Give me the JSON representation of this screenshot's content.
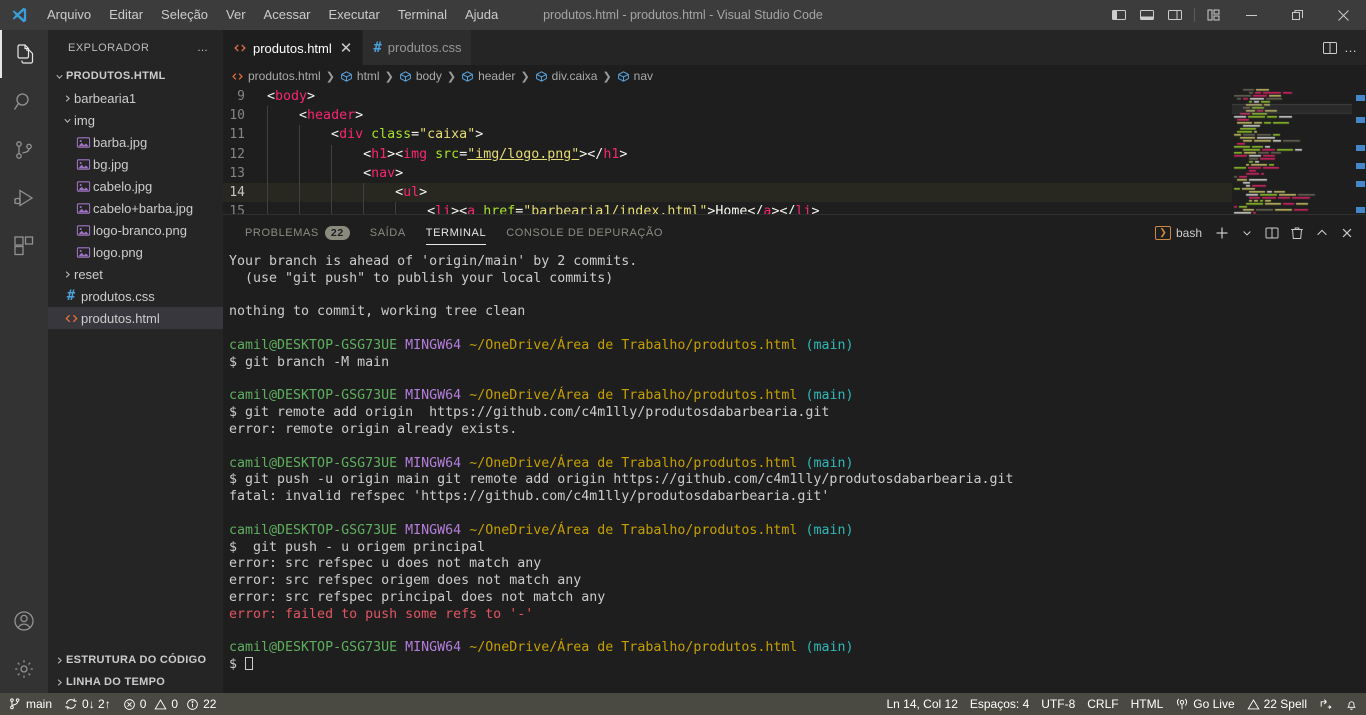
{
  "titlebar": {
    "title": "produtos.html - produtos.html - Visual Studio Code",
    "menu": [
      "Arquivo",
      "Editar",
      "Seleção",
      "Ver",
      "Acessar",
      "Executar",
      "Terminal",
      "Ajuda"
    ],
    "layout_icons": [
      "toggle-primary-sidebar-icon",
      "toggle-panel-icon",
      "toggle-secondary-sidebar-icon",
      "customize-layout-icon"
    ],
    "window_controls": [
      "minimize-button",
      "restore-button",
      "close-button"
    ]
  },
  "activitybar": {
    "items": [
      {
        "name": "explorer",
        "icon": "files-icon",
        "active": true
      },
      {
        "name": "search",
        "icon": "search-icon",
        "active": false
      },
      {
        "name": "source-control",
        "icon": "source-control-icon",
        "active": false
      },
      {
        "name": "run-debug",
        "icon": "run-debug-icon",
        "active": false
      },
      {
        "name": "extensions",
        "icon": "extensions-icon",
        "active": false
      }
    ],
    "bottom": [
      {
        "name": "accounts",
        "icon": "account-icon"
      },
      {
        "name": "manage",
        "icon": "gear-icon"
      }
    ]
  },
  "sidebar": {
    "header": "EXPLORADOR",
    "header_actions": "…",
    "root": "PRODUTOS.HTML",
    "tree": [
      {
        "label": "barbearia1",
        "type": "folder",
        "expanded": false,
        "indent": 1
      },
      {
        "label": "img",
        "type": "folder",
        "expanded": true,
        "indent": 1
      },
      {
        "label": "barba.jpg",
        "type": "image",
        "indent": 2
      },
      {
        "label": "bg.jpg",
        "type": "image",
        "indent": 2
      },
      {
        "label": "cabelo.jpg",
        "type": "image",
        "indent": 2
      },
      {
        "label": "cabelo+barba.jpg",
        "type": "image",
        "indent": 2
      },
      {
        "label": "logo-branco.png",
        "type": "image",
        "indent": 2
      },
      {
        "label": "logo.png",
        "type": "image",
        "indent": 2
      },
      {
        "label": "reset",
        "type": "folder",
        "expanded": false,
        "indent": 1
      },
      {
        "label": "produtos.css",
        "type": "css",
        "indent": 1
      },
      {
        "label": "produtos.html",
        "type": "html",
        "indent": 1,
        "selected": true
      }
    ],
    "bottom_sections": [
      "ESTRUTURA DO CÓDIGO",
      "LINHA DO TEMPO"
    ]
  },
  "editor": {
    "tabs": [
      {
        "label": "produtos.html",
        "icon": "html-file-icon",
        "active": true,
        "closable": true
      },
      {
        "label": "produtos.css",
        "icon": "css-file-icon",
        "active": false,
        "closable": false
      }
    ],
    "tab_actions": [
      "split-editor-icon",
      "more-actions-icon"
    ],
    "breadcrumbs": [
      {
        "label": "produtos.html",
        "icon": "html-file-icon"
      },
      {
        "label": "html",
        "icon": "symbol-field-icon"
      },
      {
        "label": "body",
        "icon": "symbol-field-icon"
      },
      {
        "label": "header",
        "icon": "symbol-field-icon"
      },
      {
        "label": "div.caixa",
        "icon": "symbol-field-icon"
      },
      {
        "label": "nav",
        "icon": "symbol-field-icon"
      }
    ],
    "lines": [
      {
        "num": "9",
        "indent": 0,
        "highlight": false,
        "tokens": [
          {
            "t": "punc",
            "v": "<"
          },
          {
            "t": "tag",
            "v": "body"
          },
          {
            "t": "punc",
            "v": ">"
          }
        ]
      },
      {
        "num": "10",
        "indent": 1,
        "highlight": false,
        "tokens": [
          {
            "t": "plain",
            "v": "    "
          },
          {
            "t": "punc",
            "v": "<"
          },
          {
            "t": "tag",
            "v": "header"
          },
          {
            "t": "punc",
            "v": ">"
          }
        ]
      },
      {
        "num": "11",
        "indent": 2,
        "highlight": false,
        "tokens": [
          {
            "t": "plain",
            "v": "        "
          },
          {
            "t": "punc",
            "v": "<"
          },
          {
            "t": "tag",
            "v": "div"
          },
          {
            "t": "plain",
            "v": " "
          },
          {
            "t": "attr",
            "v": "class"
          },
          {
            "t": "punc",
            "v": "="
          },
          {
            "t": "str",
            "v": "\"caixa\""
          },
          {
            "t": "punc",
            "v": ">"
          }
        ]
      },
      {
        "num": "12",
        "indent": 3,
        "highlight": false,
        "tokens": [
          {
            "t": "plain",
            "v": "            "
          },
          {
            "t": "punc",
            "v": "<"
          },
          {
            "t": "tag",
            "v": "h1"
          },
          {
            "t": "punc",
            "v": "><"
          },
          {
            "t": "tag",
            "v": "img"
          },
          {
            "t": "plain",
            "v": " "
          },
          {
            "t": "attr",
            "v": "src"
          },
          {
            "t": "punc",
            "v": "="
          },
          {
            "t": "link",
            "v": "\"img/logo.png\""
          },
          {
            "t": "punc",
            "v": "></"
          },
          {
            "t": "tag",
            "v": "h1"
          },
          {
            "t": "punc",
            "v": ">"
          }
        ]
      },
      {
        "num": "13",
        "indent": 3,
        "highlight": false,
        "tokens": [
          {
            "t": "plain",
            "v": "            "
          },
          {
            "t": "punc",
            "v": "<"
          },
          {
            "t": "tag",
            "v": "nav"
          },
          {
            "t": "punc",
            "v": ">"
          }
        ]
      },
      {
        "num": "14",
        "indent": 4,
        "highlight": true,
        "tokens": [
          {
            "t": "plain",
            "v": "                "
          },
          {
            "t": "punc",
            "v": "<"
          },
          {
            "t": "tag",
            "v": "ul"
          },
          {
            "t": "punc",
            "v": ">"
          }
        ]
      },
      {
        "num": "15",
        "indent": 5,
        "highlight": false,
        "tokens": [
          {
            "t": "plain",
            "v": "                    "
          },
          {
            "t": "punc",
            "v": "<"
          },
          {
            "t": "tag",
            "v": "li"
          },
          {
            "t": "punc",
            "v": "><"
          },
          {
            "t": "tag",
            "v": "a"
          },
          {
            "t": "plain",
            "v": " "
          },
          {
            "t": "attr",
            "v": "href"
          },
          {
            "t": "punc",
            "v": "="
          },
          {
            "t": "link",
            "v": "\"barbearia1/index.html\""
          },
          {
            "t": "punc",
            "v": ">"
          },
          {
            "t": "txt",
            "v": "Home"
          },
          {
            "t": "punc",
            "v": "</"
          },
          {
            "t": "tag",
            "v": "a"
          },
          {
            "t": "punc",
            "v": "></"
          },
          {
            "t": "tag",
            "v": "li"
          },
          {
            "t": "punc",
            "v": ">"
          }
        ]
      }
    ]
  },
  "panel": {
    "tabs": [
      {
        "label": "PROBLEMAS",
        "badge": "22",
        "active": false
      },
      {
        "label": "SAÍDA",
        "badge": "",
        "active": false
      },
      {
        "label": "TERMINAL",
        "badge": "",
        "active": true
      },
      {
        "label": "CONSOLE DE DEPURAÇÃO",
        "badge": "",
        "active": false
      }
    ],
    "shell": "bash",
    "actions": [
      "new-terminal-icon",
      "terminal-dropdown-icon",
      "split-terminal-icon",
      "kill-terminal-icon",
      "maximize-panel-icon",
      "close-panel-icon"
    ],
    "terminal_lines": [
      [
        {
          "c": "w",
          "v": "Your branch is ahead of 'origin/main' by 2 commits."
        }
      ],
      [
        {
          "c": "w",
          "v": "  (use \"git push\" to publish your local commits)"
        }
      ],
      [],
      [
        {
          "c": "w",
          "v": "nothing to commit, working tree clean"
        }
      ],
      [],
      [
        {
          "c": "g",
          "v": "camil@DESKTOP-GSG73UE"
        },
        {
          "c": "w",
          "v": " "
        },
        {
          "c": "m",
          "v": "MINGW64"
        },
        {
          "c": "w",
          "v": " "
        },
        {
          "c": "y",
          "v": "~/OneDrive/Área de Trabalho/produtos.html"
        },
        {
          "c": "w",
          "v": " "
        },
        {
          "c": "c",
          "v": "(main)"
        }
      ],
      [
        {
          "c": "w",
          "v": "$ git branch -M main"
        }
      ],
      [],
      [
        {
          "c": "g",
          "v": "camil@DESKTOP-GSG73UE"
        },
        {
          "c": "w",
          "v": " "
        },
        {
          "c": "m",
          "v": "MINGW64"
        },
        {
          "c": "w",
          "v": " "
        },
        {
          "c": "y",
          "v": "~/OneDrive/Área de Trabalho/produtos.html"
        },
        {
          "c": "w",
          "v": " "
        },
        {
          "c": "c",
          "v": "(main)"
        }
      ],
      [
        {
          "c": "w",
          "v": "$ git remote add origin  https://github.com/c4m1lly/produtosdabarbearia.git"
        }
      ],
      [
        {
          "c": "w",
          "v": "error: remote origin already exists."
        }
      ],
      [],
      [
        {
          "c": "g",
          "v": "camil@DESKTOP-GSG73UE"
        },
        {
          "c": "w",
          "v": " "
        },
        {
          "c": "m",
          "v": "MINGW64"
        },
        {
          "c": "w",
          "v": " "
        },
        {
          "c": "y",
          "v": "~/OneDrive/Área de Trabalho/produtos.html"
        },
        {
          "c": "w",
          "v": " "
        },
        {
          "c": "c",
          "v": "(main)"
        }
      ],
      [
        {
          "c": "w",
          "v": "$ git push -u origin main git remote add origin https://github.com/c4m1lly/produtosdabarbearia.git"
        }
      ],
      [
        {
          "c": "w",
          "v": "fatal: invalid refspec 'https://github.com/c4m1lly/produtosdabarbearia.git'"
        }
      ],
      [],
      [
        {
          "c": "g",
          "v": "camil@DESKTOP-GSG73UE"
        },
        {
          "c": "w",
          "v": " "
        },
        {
          "c": "m",
          "v": "MINGW64"
        },
        {
          "c": "w",
          "v": " "
        },
        {
          "c": "y",
          "v": "~/OneDrive/Área de Trabalho/produtos.html"
        },
        {
          "c": "w",
          "v": " "
        },
        {
          "c": "c",
          "v": "(main)"
        }
      ],
      [
        {
          "c": "w",
          "v": "$  git push - u origem principal"
        }
      ],
      [
        {
          "c": "w",
          "v": "error: src refspec u does not match any"
        }
      ],
      [
        {
          "c": "w",
          "v": "error: src refspec origem does not match any"
        }
      ],
      [
        {
          "c": "w",
          "v": "error: src refspec principal does not match any"
        }
      ],
      [
        {
          "c": "r",
          "v": "error: failed to push some refs to '-'"
        }
      ],
      [],
      [
        {
          "c": "g",
          "v": "camil@DESKTOP-GSG73UE"
        },
        {
          "c": "w",
          "v": " "
        },
        {
          "c": "m",
          "v": "MINGW64"
        },
        {
          "c": "w",
          "v": " "
        },
        {
          "c": "y",
          "v": "~/OneDrive/Área de Trabalho/produtos.html"
        },
        {
          "c": "w",
          "v": " "
        },
        {
          "c": "c",
          "v": "(main)"
        }
      ],
      [
        {
          "c": "w",
          "v": "$ "
        },
        {
          "c": "cursor",
          "v": ""
        }
      ]
    ]
  },
  "statusbar": {
    "branch": "main",
    "sync": "0↓ 2↑",
    "errors": "0",
    "warnings": "0",
    "infos": "22",
    "position": "Ln 14, Col 12",
    "indentation": "Espaços: 4",
    "encoding": "UTF-8",
    "eol": "CRLF",
    "language": "HTML",
    "golive": "Go Live",
    "spell": "22 Spell",
    "remote_icon": "remote-window-icon",
    "bell_icon": "bell-icon"
  }
}
